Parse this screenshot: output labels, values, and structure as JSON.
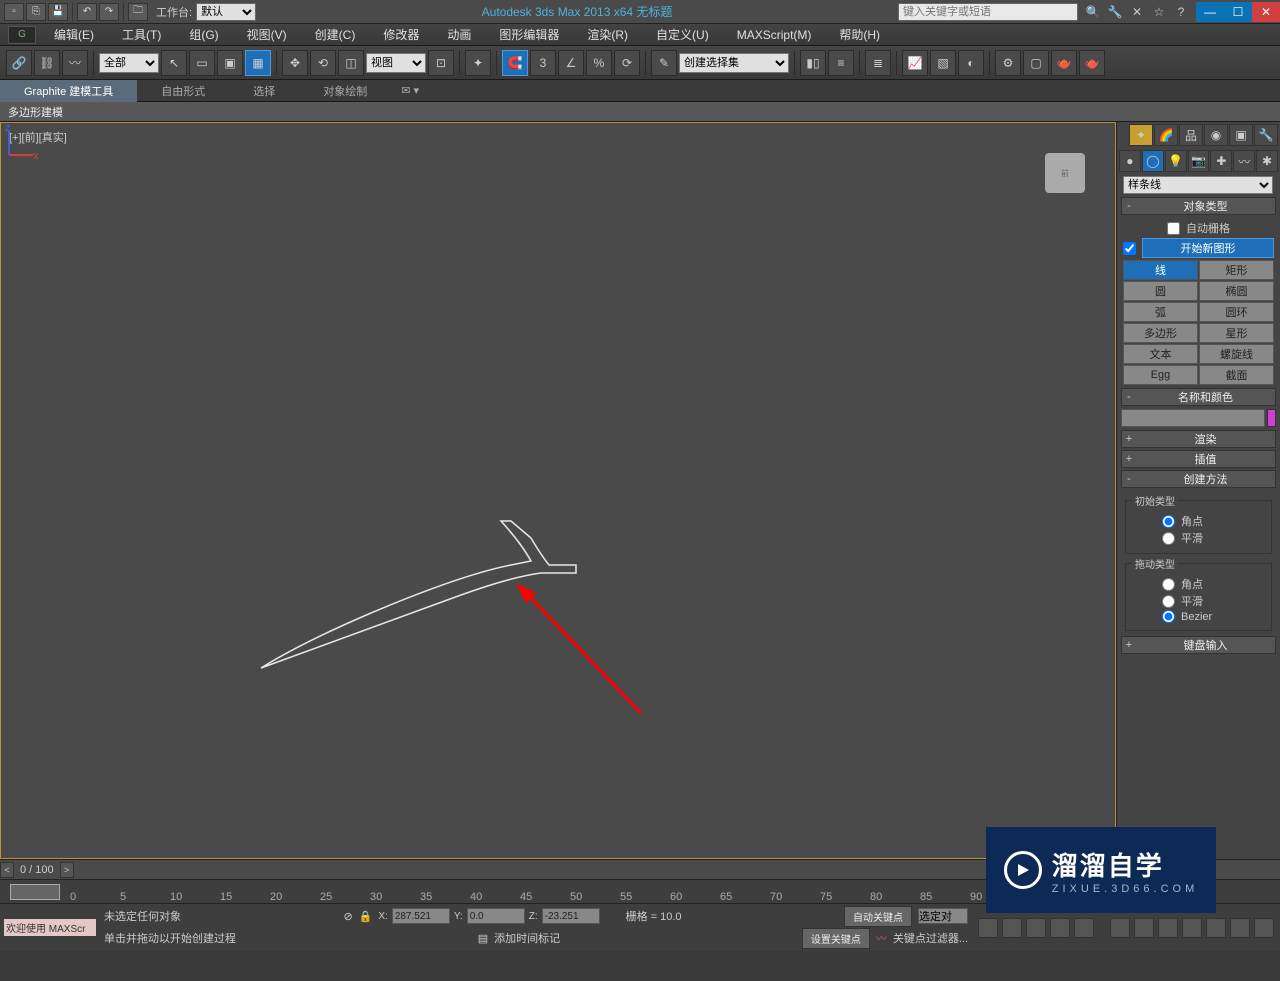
{
  "titlebar": {
    "workspace_label": "工作台:",
    "workspace_value": "默认",
    "title": "Autodesk 3ds Max  2013 x64   无标题",
    "search_placeholder": "键入关键字或短语"
  },
  "menus": [
    "编辑(E)",
    "工具(T)",
    "组(G)",
    "视图(V)",
    "创建(C)",
    "修改器",
    "动画",
    "图形编辑器",
    "渲染(R)",
    "自定义(U)",
    "MAXScript(M)",
    "帮助(H)"
  ],
  "main_toolbar": {
    "filter_dropdown": "全部",
    "view_dropdown": "视图",
    "named_sets_dropdown": "创建选择集"
  },
  "ribbon": {
    "tabs": [
      "Graphite 建模工具",
      "自由形式",
      "选择",
      "对象绘制"
    ],
    "active": 0,
    "subtab": "多边形建模"
  },
  "viewport": {
    "label": "[+][前][真实]"
  },
  "command_panel": {
    "category_dropdown": "样条线",
    "object_type_title": "对象类型",
    "auto_grid_label": "自动栅格",
    "start_new_label": "开始新图形",
    "buttons": [
      "线",
      "矩形",
      "圆",
      "椭圆",
      "弧",
      "圆环",
      "多边形",
      "星形",
      "文本",
      "螺旋线",
      "Egg",
      "截面"
    ],
    "name_color_title": "名称和颜色",
    "render_title": "渲染",
    "interp_title": "插值",
    "create_method_title": "创建方法",
    "initial_type_label": "初始类型",
    "drag_type_label": "拖动类型",
    "radio_corner": "角点",
    "radio_smooth": "平滑",
    "radio_bezier": "Bezier",
    "keyboard_title": "键盘输入"
  },
  "timeline": {
    "frame_label": "0 / 100"
  },
  "statusbar": {
    "welcome": "欢迎使用  MAXScr",
    "no_selection": "未选定任何对象",
    "prompt": "单击并拖动以开始创建过程",
    "x_label": "X:",
    "x_val": "287.521",
    "y_label": "Y:",
    "y_val": "0.0",
    "z_label": "Z:",
    "z_val": "-23.251",
    "grid_label": "栅格 = 10.0",
    "add_time_tag": "添加时间标记",
    "auto_key": "自动关键点",
    "set_key": "设置关键点",
    "selected": "选定对",
    "key_filters": "关键点过滤器..."
  },
  "watermark": {
    "big": "溜溜自学",
    "small": "ZIXUE.3D66.COM"
  }
}
